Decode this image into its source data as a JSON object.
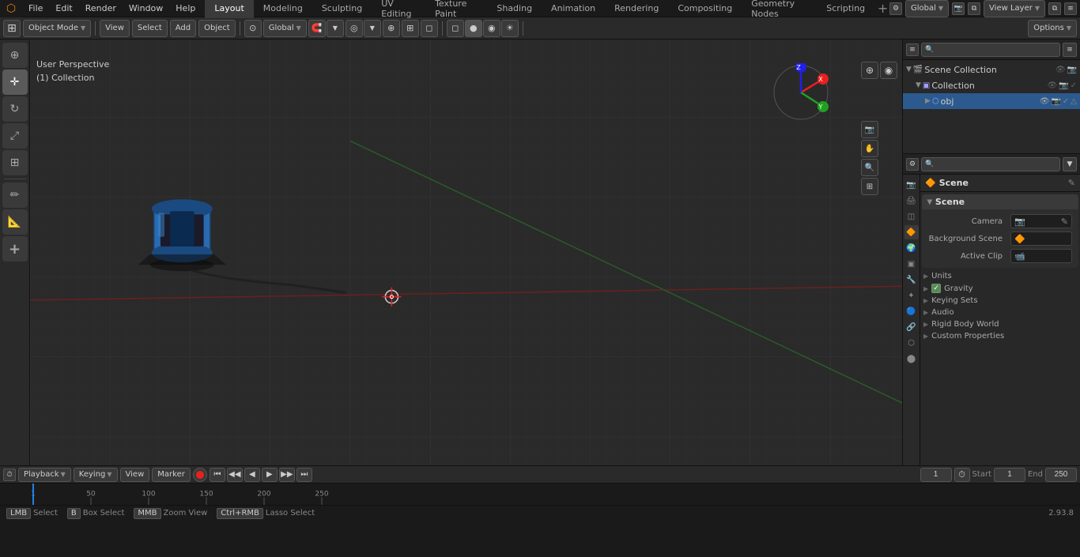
{
  "app": {
    "title": "Blender",
    "version": "2.93.8",
    "logo": "🔶"
  },
  "top_menu": {
    "items": [
      "File",
      "Edit",
      "Render",
      "Window",
      "Help"
    ]
  },
  "workspace_tabs": {
    "tabs": [
      "Layout",
      "Modeling",
      "Sculpting",
      "UV Editing",
      "Texture Paint",
      "Shading",
      "Animation",
      "Rendering",
      "Compositing",
      "Geometry Nodes",
      "Scripting"
    ],
    "active": "Layout"
  },
  "header_toolbar": {
    "mode_btn": "Object Mode",
    "view_btn": "View",
    "select_btn": "Select",
    "add_btn": "Add",
    "object_btn": "Object",
    "pivot_btn": "Global",
    "options_btn": "Options"
  },
  "viewport": {
    "title": "User Perspective",
    "breadcrumb_line1": "User Perspective",
    "breadcrumb_line2": "(1) Collection",
    "mode_btn": "Object Mode",
    "view_btn": "View",
    "select_btn": "Select",
    "add_btn": "Add",
    "object_btn": "Object"
  },
  "outliner": {
    "title": "Scene Collection",
    "items": [
      {
        "label": "Collection",
        "icon": "collection",
        "expanded": true,
        "children": [
          {
            "label": "obj",
            "icon": "mesh",
            "expanded": false
          }
        ]
      }
    ]
  },
  "properties": {
    "panel_title": "Scene",
    "section_scene": {
      "title": "Scene",
      "camera_label": "Camera",
      "camera_value": "",
      "background_scene_label": "Background Scene",
      "background_scene_value": "",
      "active_clip_label": "Active Clip",
      "active_clip_value": ""
    },
    "section_units": {
      "title": "Units",
      "expanded": false
    },
    "section_gravity": {
      "title": "Gravity",
      "checked": true
    },
    "section_keying_sets": {
      "title": "Keying Sets",
      "expanded": false
    },
    "section_audio": {
      "title": "Audio",
      "expanded": false
    },
    "section_rigid_body_world": {
      "title": "Rigid Body World",
      "expanded": false
    },
    "section_custom_properties": {
      "title": "Custom Properties",
      "expanded": false
    }
  },
  "timeline": {
    "playback_btn": "Playback",
    "keying_btn": "Keying",
    "view_btn": "View",
    "marker_btn": "Marker",
    "current_frame": "1",
    "start_frame": "1",
    "end_frame": "250",
    "frame_markers": [
      "1",
      "50",
      "100",
      "150",
      "200",
      "250"
    ]
  },
  "status_bar": {
    "select": "Select",
    "box_select": "Box Select",
    "zoom": "Zoom View",
    "lasso": "Lasso Select",
    "version": "2.93.8"
  },
  "icons": {
    "cursor": "⊕",
    "move": "✛",
    "rotate": "↻",
    "scale": "⤢",
    "transform": "⊞",
    "annotation": "✏",
    "measure": "📏",
    "add": "+",
    "scene": "🔶",
    "camera": "📷",
    "expand": "▶",
    "collapse": "▼",
    "eye": "👁",
    "filter": "≡",
    "search": "🔍",
    "pencil": "✎",
    "link": "🔗"
  }
}
